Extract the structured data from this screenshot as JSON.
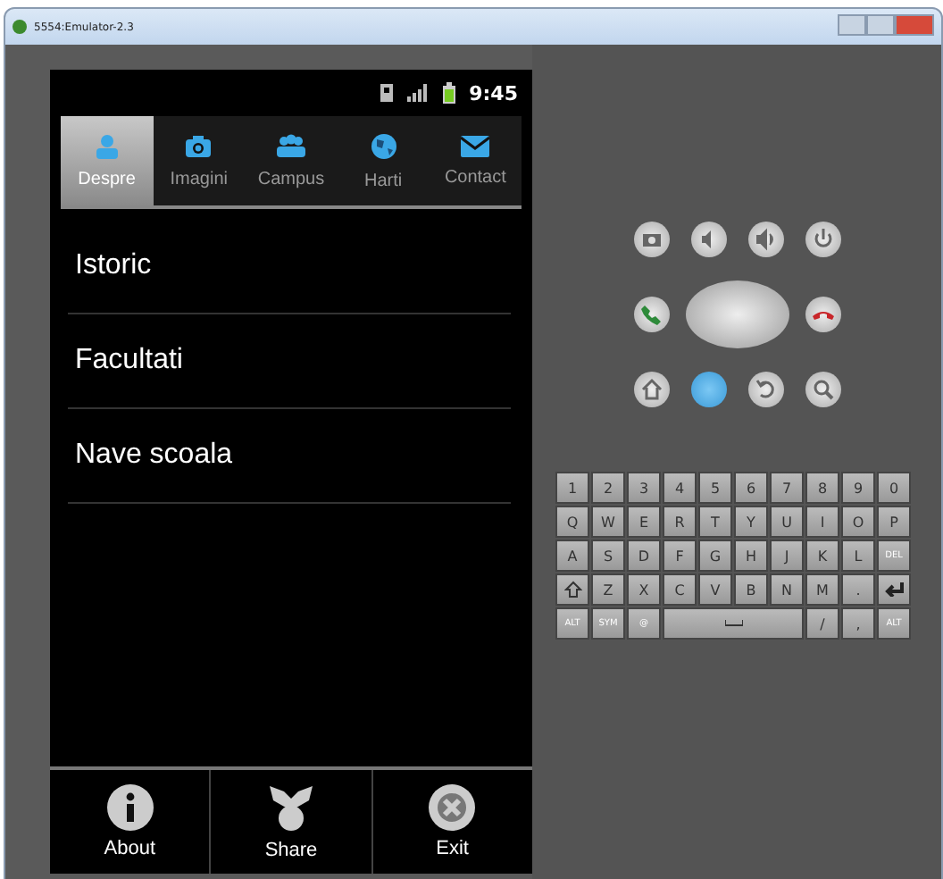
{
  "window": {
    "title": "5554:Emulator-2.3"
  },
  "status_bar": {
    "time": "9:45"
  },
  "tabs": [
    {
      "label": "Despre",
      "selected": true
    },
    {
      "label": "Imagini",
      "selected": false
    },
    {
      "label": "Campus",
      "selected": false
    },
    {
      "label": "Harti",
      "selected": false
    },
    {
      "label": "Contact",
      "selected": false
    }
  ],
  "list": [
    {
      "label": "Istoric"
    },
    {
      "label": "Facultati"
    },
    {
      "label": "Nave scoala"
    }
  ],
  "menu": [
    {
      "label": "About"
    },
    {
      "label": "Share"
    },
    {
      "label": "Exit"
    }
  ],
  "keyboard": [
    [
      {
        "kind": "char",
        "label": "1"
      },
      {
        "kind": "char",
        "label": "2"
      },
      {
        "kind": "char",
        "label": "3"
      },
      {
        "kind": "char",
        "label": "4"
      },
      {
        "kind": "char",
        "label": "5"
      },
      {
        "kind": "char",
        "label": "6"
      },
      {
        "kind": "char",
        "label": "7"
      },
      {
        "kind": "char",
        "label": "8"
      },
      {
        "kind": "char",
        "label": "9"
      },
      {
        "kind": "char",
        "label": "0"
      }
    ],
    [
      {
        "kind": "char",
        "label": "Q"
      },
      {
        "kind": "char",
        "label": "W"
      },
      {
        "kind": "char",
        "label": "E"
      },
      {
        "kind": "char",
        "label": "R"
      },
      {
        "kind": "char",
        "label": "T"
      },
      {
        "kind": "char",
        "label": "Y"
      },
      {
        "kind": "char",
        "label": "U"
      },
      {
        "kind": "char",
        "label": "I"
      },
      {
        "kind": "char",
        "label": "O"
      },
      {
        "kind": "char",
        "label": "P"
      }
    ],
    [
      {
        "kind": "char",
        "label": "A"
      },
      {
        "kind": "char",
        "label": "S"
      },
      {
        "kind": "char",
        "label": "D"
      },
      {
        "kind": "char",
        "label": "F"
      },
      {
        "kind": "char",
        "label": "G"
      },
      {
        "kind": "char",
        "label": "H"
      },
      {
        "kind": "char",
        "label": "J"
      },
      {
        "kind": "char",
        "label": "K"
      },
      {
        "kind": "char",
        "label": "L"
      },
      {
        "kind": "small",
        "label": "DEL"
      }
    ],
    [
      {
        "kind": "shift"
      },
      {
        "kind": "char",
        "label": "Z"
      },
      {
        "kind": "char",
        "label": "X"
      },
      {
        "kind": "char",
        "label": "C"
      },
      {
        "kind": "char",
        "label": "V"
      },
      {
        "kind": "char",
        "label": "B"
      },
      {
        "kind": "char",
        "label": "N"
      },
      {
        "kind": "char",
        "label": "M"
      },
      {
        "kind": "char",
        "label": "."
      },
      {
        "kind": "enter"
      }
    ],
    [
      {
        "kind": "small",
        "label": "ALT"
      },
      {
        "kind": "small",
        "label": "SYM"
      },
      {
        "kind": "small",
        "label": "@"
      },
      {
        "kind": "space"
      },
      {
        "kind": "char",
        "label": "/"
      },
      {
        "kind": "char",
        "label": ","
      },
      {
        "kind": "small",
        "label": "ALT"
      }
    ]
  ]
}
